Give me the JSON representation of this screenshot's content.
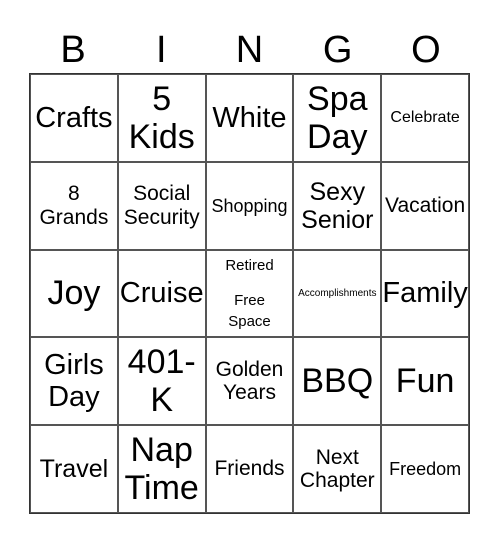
{
  "header": [
    "B",
    "I",
    "N",
    "G",
    "O"
  ],
  "cells": [
    {
      "text": "Crafts",
      "size": "s30"
    },
    {
      "text": "5\nKids",
      "size": "s36"
    },
    {
      "text": "White",
      "size": "s30"
    },
    {
      "text": "Spa\nDay",
      "size": "s36"
    },
    {
      "text": "Celebrate",
      "size": "s16"
    },
    {
      "text": "8\nGrands",
      "size": "s22"
    },
    {
      "text": "Social\nSecurity",
      "size": "s22"
    },
    {
      "text": "Shopping",
      "size": "s18"
    },
    {
      "text": "Sexy\nSenior",
      "size": "s26"
    },
    {
      "text": "Vacation",
      "size": "s22"
    },
    {
      "text": "Joy",
      "size": "s36"
    },
    {
      "text": "Cruise",
      "size": "s30"
    },
    {
      "text": "Retired",
      "size": "free",
      "free_label": "Free\nSpace"
    },
    {
      "text": "Accomplishments",
      "size": "s10"
    },
    {
      "text": "Family",
      "size": "s30"
    },
    {
      "text": "Girls\nDay",
      "size": "s30"
    },
    {
      "text": "401-\nK",
      "size": "s36"
    },
    {
      "text": "Golden\nYears",
      "size": "s22"
    },
    {
      "text": "BBQ",
      "size": "s36"
    },
    {
      "text": "Fun",
      "size": "s36"
    },
    {
      "text": "Travel",
      "size": "s26"
    },
    {
      "text": "Nap\nTime",
      "size": "s36"
    },
    {
      "text": "Friends",
      "size": "s22"
    },
    {
      "text": "Next\nChapter",
      "size": "s22"
    },
    {
      "text": "Freedom",
      "size": "s18"
    }
  ]
}
